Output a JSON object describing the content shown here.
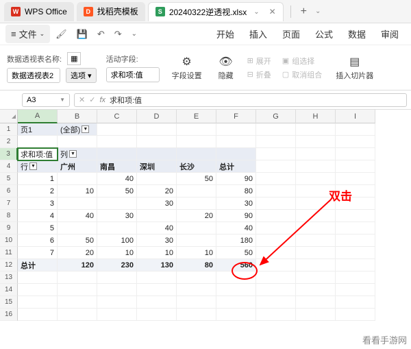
{
  "titlebar": {
    "tabs": [
      {
        "label": "WPS Office",
        "icon_bg": "#d9301f",
        "icon_text": "W"
      },
      {
        "label": "找稻壳模板",
        "icon_bg": "#ff5722",
        "icon_text": "D"
      },
      {
        "label": "20240322逆透视.xlsx",
        "icon_bg": "#2e9c5b",
        "icon_text": "S",
        "active": true
      }
    ],
    "add": "+"
  },
  "menu": {
    "file": "文件",
    "items": [
      "开始",
      "插入",
      "页面",
      "公式",
      "数据",
      "审阅"
    ]
  },
  "ribbon": {
    "pivot_name_label": "数据透视表名称:",
    "pivot_name_value": "数据透视表2",
    "options_btn": "选项",
    "active_field_label": "活动字段:",
    "active_field_value": "求和项:值",
    "field_settings": "字段设置",
    "hide": "隐藏",
    "expand": "展开",
    "collapse": "折叠",
    "group_select": "组选择",
    "ungroup": "取消组合",
    "insert_slicer": "插入切片器"
  },
  "formulabar": {
    "namebox": "A3",
    "fx": "fx",
    "value": "求和项:值"
  },
  "columns": [
    "A",
    "B",
    "C",
    "D",
    "E",
    "F",
    "G",
    "H",
    "I"
  ],
  "row_numbers": [
    "1",
    "2",
    "3",
    "4",
    "5",
    "6",
    "7",
    "8",
    "9",
    "10",
    "11",
    "12",
    "13",
    "14",
    "15",
    "16"
  ],
  "pivot": {
    "page_field": "页1",
    "page_value": "(全部)",
    "data_field": "求和项:值",
    "col_label": "列",
    "row_label": "行",
    "col_headers": [
      "广州",
      "南昌",
      "深圳",
      "长沙",
      "总计"
    ],
    "rows": [
      {
        "key": "1",
        "vals": [
          "",
          "40",
          "",
          "50",
          "90"
        ]
      },
      {
        "key": "2",
        "vals": [
          "10",
          "50",
          "20",
          "",
          "80"
        ]
      },
      {
        "key": "3",
        "vals": [
          "",
          "",
          "30",
          "",
          "30"
        ]
      },
      {
        "key": "4",
        "vals": [
          "40",
          "30",
          "",
          "20",
          "90"
        ]
      },
      {
        "key": "5",
        "vals": [
          "",
          "",
          "40",
          "",
          "40"
        ]
      },
      {
        "key": "6",
        "vals": [
          "50",
          "100",
          "30",
          "",
          "180"
        ]
      },
      {
        "key": "7",
        "vals": [
          "20",
          "10",
          "10",
          "10",
          "50"
        ]
      }
    ],
    "total_label": "总计",
    "totals": [
      "120",
      "230",
      "130",
      "80",
      "560"
    ]
  },
  "annotation": {
    "text": "双击"
  },
  "watermark": "看看手游网"
}
